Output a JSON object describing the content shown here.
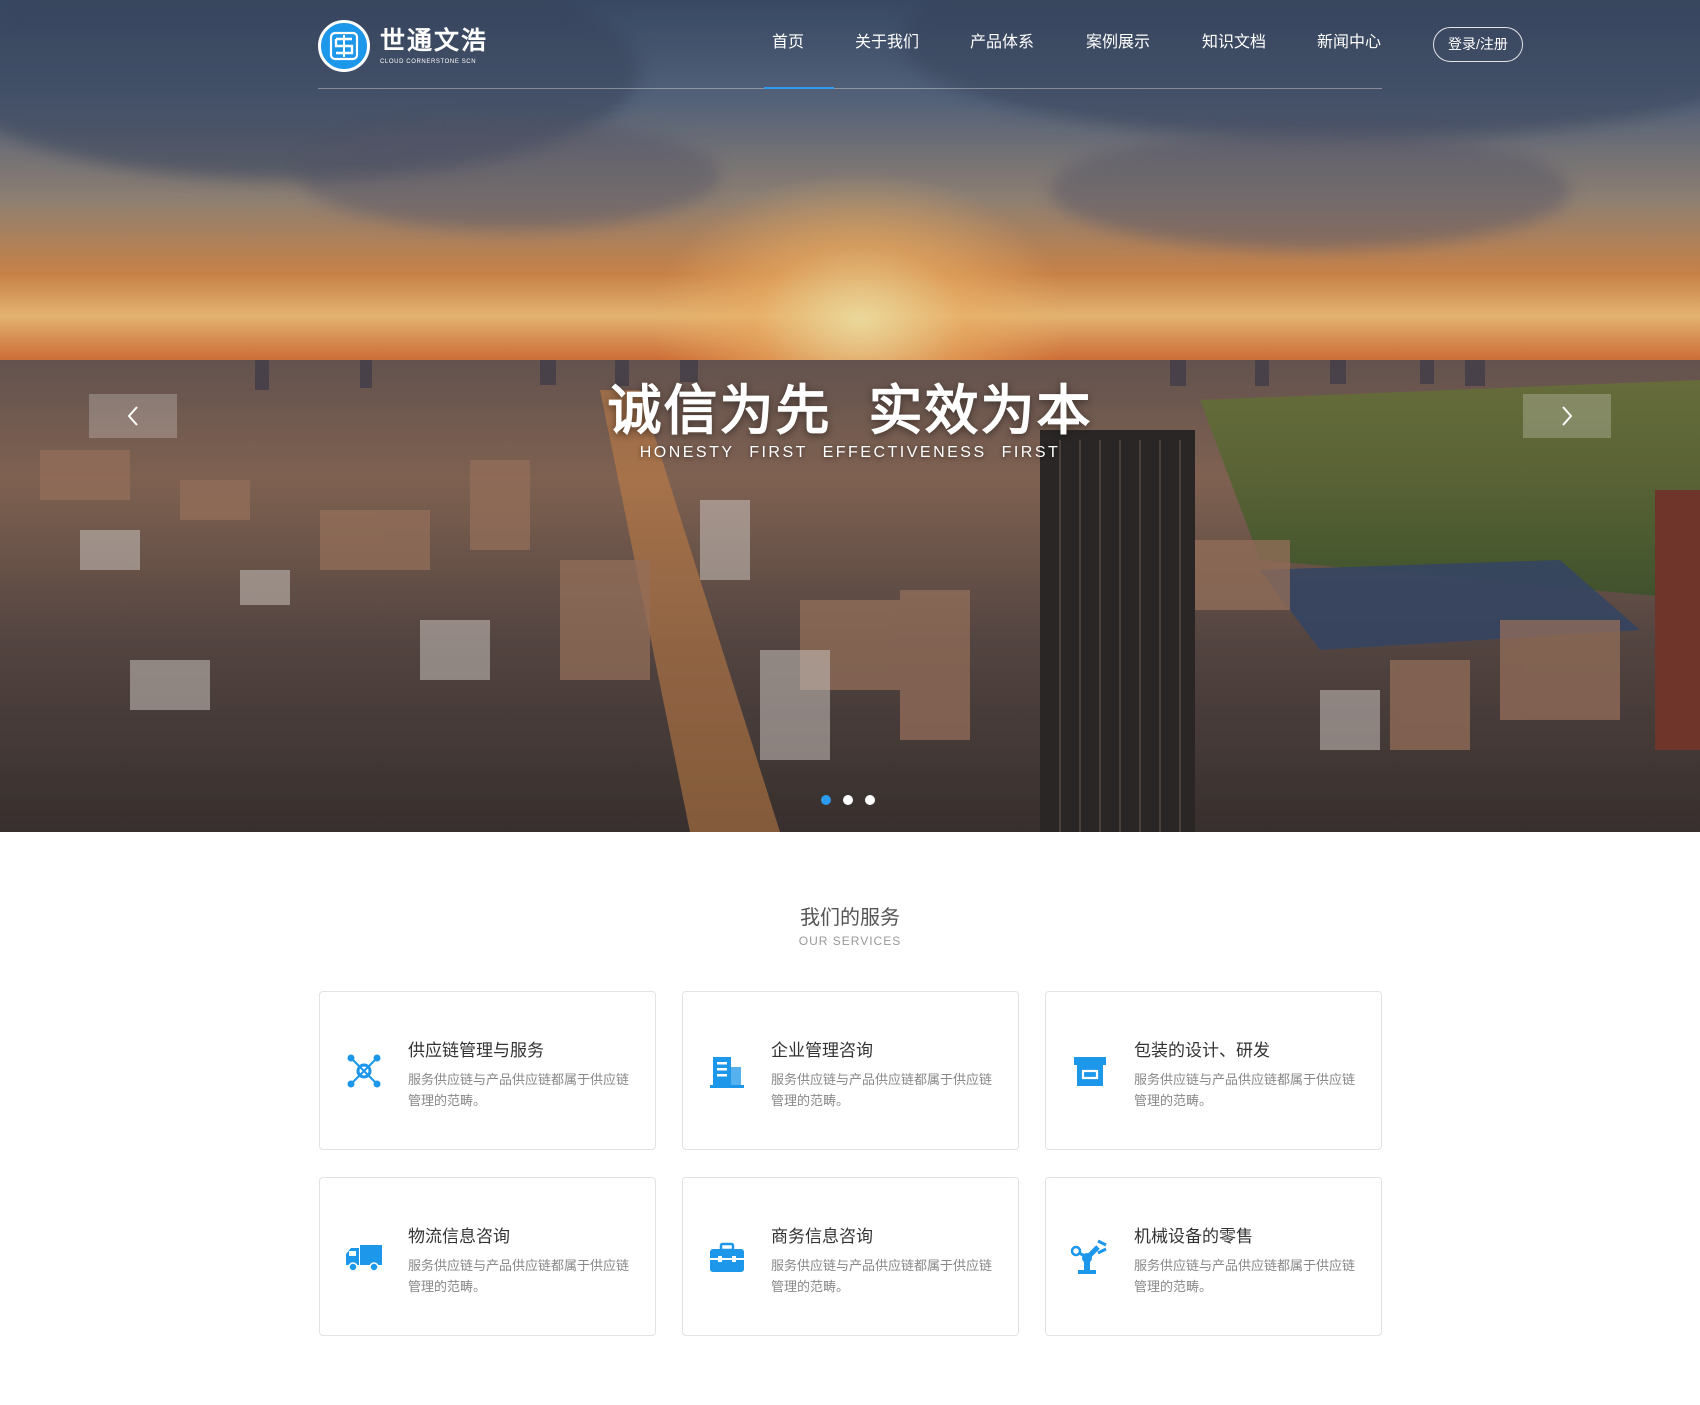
{
  "brand": {
    "name": "世通文浩",
    "subtitle": "CLOUD CORNERSTONE SCN",
    "accent_color": "#1d97ea"
  },
  "nav": {
    "items": [
      {
        "label": "首页",
        "active": true
      },
      {
        "label": "关于我们"
      },
      {
        "label": "产品体系"
      },
      {
        "label": "案例展示"
      },
      {
        "label": "知识文档"
      },
      {
        "label": "新闻中心"
      }
    ],
    "login_label": "登录/注册"
  },
  "hero": {
    "title": "诚信为先 实效为本",
    "subtitle": "HONESTY FIRST EFFECTIVENESS FIRST",
    "prev_icon": "chevron-left-icon",
    "next_icon": "chevron-right-icon",
    "slide_count": 3,
    "active_slide": 1
  },
  "services": {
    "title": "我们的服务",
    "subtitle": "OUR SERVICES",
    "items": [
      {
        "title": "供应链管理与服务",
        "desc": "服务供应链与产品供应链都属于供应链管理的范畴。",
        "icon": "network-icon"
      },
      {
        "title": "企业管理咨询",
        "desc": "服务供应链与产品供应链都属于供应链管理的范畴。",
        "icon": "building-icon"
      },
      {
        "title": "包装的设计、研发",
        "desc": "服务供应链与产品供应链都属于供应链管理的范畴。",
        "icon": "package-box-icon"
      },
      {
        "title": "物流信息咨询",
        "desc": "服务供应链与产品供应链都属于供应链管理的范畴。",
        "icon": "truck-icon"
      },
      {
        "title": "商务信息咨询",
        "desc": "服务供应链与产品供应链都属于供应链管理的范畴。",
        "icon": "briefcase-icon"
      },
      {
        "title": "机械设备的零售",
        "desc": "服务供应链与产品供应链都属于供应链管理的范畴。",
        "icon": "robot-arm-icon"
      }
    ]
  }
}
